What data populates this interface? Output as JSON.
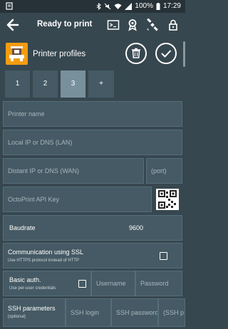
{
  "status_bar": {
    "time": "17:29",
    "battery": "100%"
  },
  "toolbar": {
    "title": "Ready to print",
    "icons": [
      "back-arrow-icon",
      "terminal-icon",
      "badge-icon",
      "satellite-icon",
      "lock-icon"
    ]
  },
  "header": {
    "title": "Printer profiles",
    "logo_icon": "printer-logo-icon",
    "delete_icon": "trash-icon",
    "confirm_icon": "check-icon"
  },
  "profile_tabs": {
    "tab1": "1",
    "tab2": "2",
    "tab3": "3",
    "add": "+"
  },
  "form": {
    "printer_name": "Printer name",
    "local_ip": "Local IP or DNS (LAN)",
    "distant_ip": "Distant IP or DNS (WAN)",
    "port": "(port)",
    "api_key": "OctoPrint API Key",
    "baudrate_label": "Baudrate",
    "baudrate_value": "9600",
    "ssl_title": "Communication using SSL",
    "ssl_sub": "Use HTTPS protocol instead of HTTP",
    "basic_auth_title": "Basic auth.",
    "basic_auth_sub": "Use per-user credentials",
    "username": "Username",
    "password": "Password",
    "ssh_title": "SSH parameters",
    "ssh_sub": "(optional)",
    "ssh_login": "SSH login",
    "ssh_password": "SSH password",
    "ssh_port": "(SSH p"
  },
  "colors": {
    "background": "#37474f",
    "field": "#455a64",
    "active_tab": "#78909c",
    "logo": "#f39c12"
  }
}
